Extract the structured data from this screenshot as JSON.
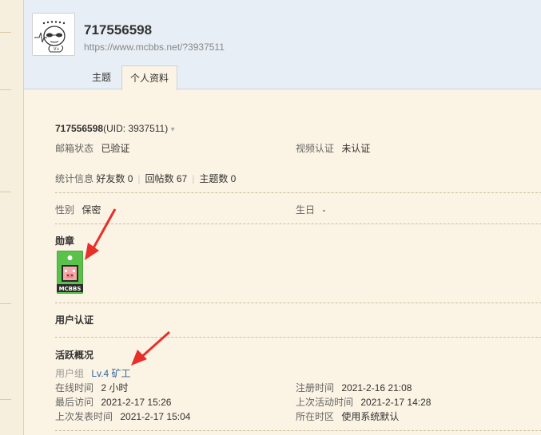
{
  "profile": {
    "username": "717556598",
    "url": "https://www.mcbbs.net/?3937511",
    "uid_text": "(UID: 3937511)",
    "uid_caret": "▾"
  },
  "tabs": [
    {
      "label": "主题"
    },
    {
      "label": "个人资料"
    }
  ],
  "info": {
    "email_label": "邮箱状态",
    "email_value": "已验证",
    "video_label": "视频认证",
    "video_value": "未认证",
    "stats_label": "统计信息",
    "friends": "好友数 0",
    "replies": "回帖数 67",
    "threads": "主题数 0",
    "gender_label": "性别",
    "gender_value": "保密",
    "birthday_label": "生日",
    "birthday_value": "-"
  },
  "sections": {
    "medals": "勋章",
    "medal_text": "MCBBS",
    "user_auth": "用户认证",
    "activity": "活跃概况"
  },
  "activity": {
    "group_label": "用户组",
    "group_value": "Lv.4 矿工",
    "online_label": "在线时间",
    "online_value": "2 小时",
    "register_label": "注册时间",
    "register_value": "2021-2-16 21:08",
    "last_visit_label": "最后访问",
    "last_visit_value": "2021-2-17 15:26",
    "last_active_label": "上次活动时间",
    "last_active_value": "2021-2-17 14:28",
    "last_post_label": "上次发表时间",
    "last_post_value": "2021-2-17 15:04",
    "timezone_label": "所在时区",
    "timezone_value": "使用系统默认"
  },
  "colors": {
    "header_bg": "#e8eef5",
    "panel_bg": "#fbf3e3",
    "link": "#336699",
    "arrow": "#e8302a",
    "medal_green": "#5ac24a"
  }
}
